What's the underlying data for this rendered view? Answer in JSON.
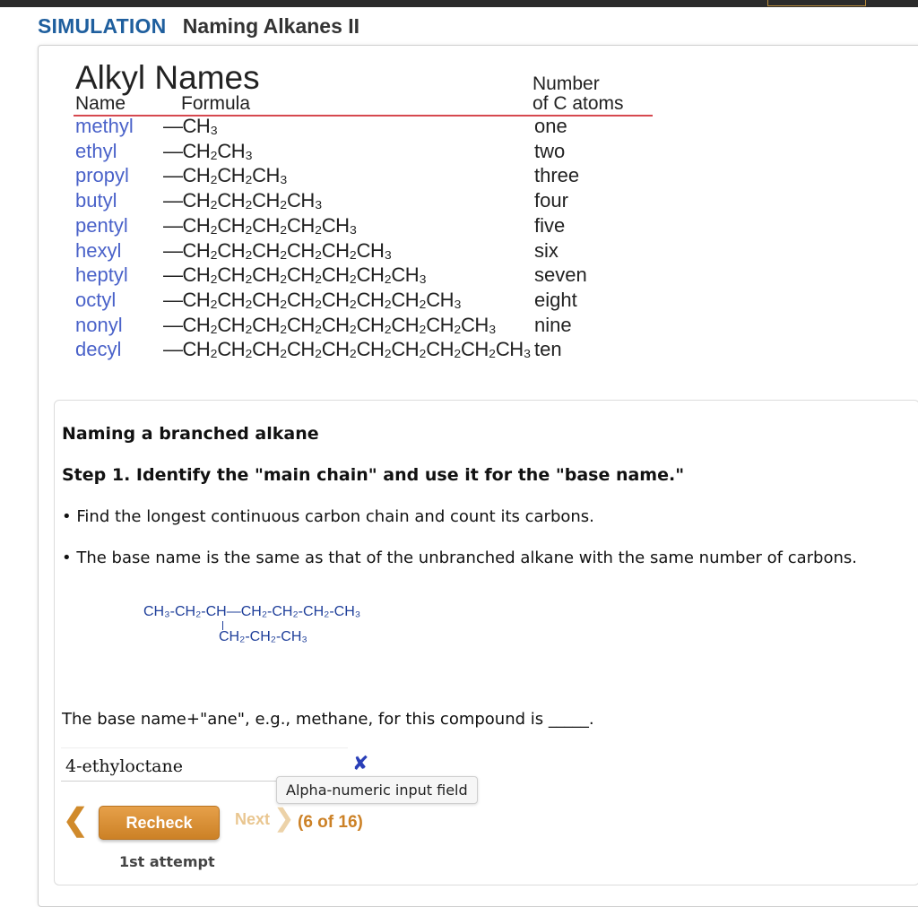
{
  "header": {
    "simulation_label": "SIMULATION",
    "title": "Naming Alkanes II"
  },
  "alkyl_table": {
    "title": "Alkyl Names",
    "col_name": "Name",
    "col_formula": "Formula",
    "col_count_line1": "Number",
    "col_count_line2": "of C atoms",
    "rows": [
      {
        "name": "methyl",
        "formula": "—CH₃",
        "count": "one"
      },
      {
        "name": "ethyl",
        "formula": "—CH₂CH₃",
        "count": "two"
      },
      {
        "name": "propyl",
        "formula": "—CH₂CH₂CH₃",
        "count": "three"
      },
      {
        "name": "butyl",
        "formula": "—CH₂CH₂CH₂CH₃",
        "count": "four"
      },
      {
        "name": "pentyl",
        "formula": "—CH₂CH₂CH₂CH₂CH₃",
        "count": "five"
      },
      {
        "name": "hexyl",
        "formula": "—CH₂CH₂CH₂CH₂CH₂CH₃",
        "count": "six"
      },
      {
        "name": "heptyl",
        "formula": "—CH₂CH₂CH₂CH₂CH₂CH₂CH₃",
        "count": "seven"
      },
      {
        "name": "octyl",
        "formula": "—CH₂CH₂CH₂CH₂CH₂CH₂CH₂CH₃",
        "count": "eight"
      },
      {
        "name": "nonyl",
        "formula": "—CH₂CH₂CH₂CH₂CH₂CH₂CH₂CH₂CH₃",
        "count": "nine"
      },
      {
        "name": "decyl",
        "formula": "—CH₂CH₂CH₂CH₂CH₂CH₂CH₂CH₂CH₂CH₃",
        "count": "ten"
      }
    ]
  },
  "step": {
    "heading": "Naming a branched alkane",
    "step1": "Step 1. Identify the \"main chain\" and use it for the \"base name.\"",
    "bullet1": "Find the longest continuous carbon chain and count its carbons.",
    "bullet2": "The base name is the same as that of the unbranched alkane with the same number of carbons.",
    "structure_line1": "CH₃-CH₂-CH—CH₂-CH₂-CH₂-CH₃",
    "structure_line2": "CH₂-CH₂-CH₃",
    "question": "The base name+\"ane\", e.g., methane, for this compound is _____.",
    "answer_value": "4-ethyloctane",
    "tooltip": "Alpha-numeric input field"
  },
  "controls": {
    "recheck_label": "Recheck",
    "next_label": "Next",
    "progress": "(6 of 16)",
    "attempt": "1st attempt"
  }
}
